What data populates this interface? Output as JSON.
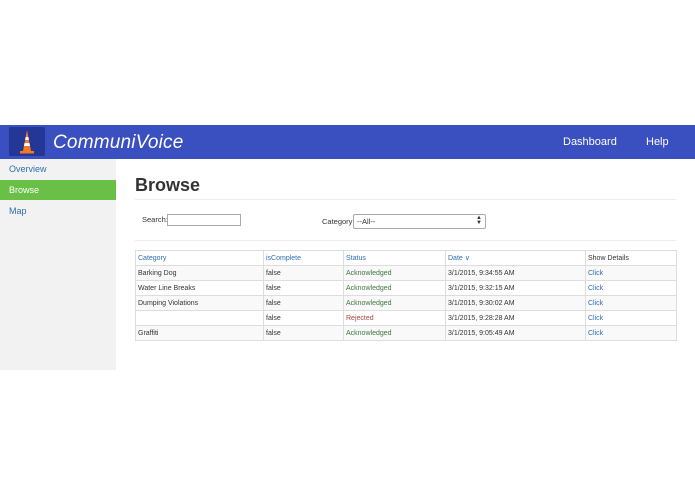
{
  "app": {
    "brand": "CommuniVoice"
  },
  "nav": {
    "dashboard": "Dashboard",
    "help": "Help"
  },
  "sidebar": {
    "items": [
      {
        "label": "Overview",
        "active": false
      },
      {
        "label": "Browse",
        "active": true
      },
      {
        "label": "Map",
        "active": false
      }
    ]
  },
  "page": {
    "title": "Browse"
  },
  "filters": {
    "search_label": "Search:",
    "search_value": "",
    "category_label": "Category",
    "category_selected": "--All--"
  },
  "table": {
    "headers": [
      "Category",
      "isComplete",
      "Status",
      "Date ∨",
      "Show Details"
    ],
    "rows": [
      {
        "category": "Barking Dog",
        "complete": "false",
        "status": "Acknowledged",
        "date": "3/1/2015, 9:34:55 AM",
        "details": "Click"
      },
      {
        "category": "Water Line Breaks",
        "complete": "false",
        "status": "Acknowledged",
        "date": "3/1/2015, 9:32:15 AM",
        "details": "Click"
      },
      {
        "category": "Dumping Violations",
        "complete": "false",
        "status": "Acknowledged",
        "date": "3/1/2015, 9:30:02 AM",
        "details": "Click"
      },
      {
        "category": "",
        "complete": "false",
        "status": "Rejected",
        "date": "3/1/2015, 9:28:28 AM",
        "details": "Click"
      },
      {
        "category": "Graffiti",
        "complete": "false",
        "status": "Acknowledged",
        "date": "3/1/2015, 9:05:49 AM",
        "details": "Click"
      }
    ]
  },
  "colors": {
    "navbar": "#3a4fc0",
    "active_item": "#6abf47",
    "link": "#2d6fb4",
    "acknowledged": "#3c763d",
    "rejected": "#a94442"
  },
  "icons": {
    "logo": "traffic-cone-icon",
    "select": "chevron-updown-icon"
  }
}
